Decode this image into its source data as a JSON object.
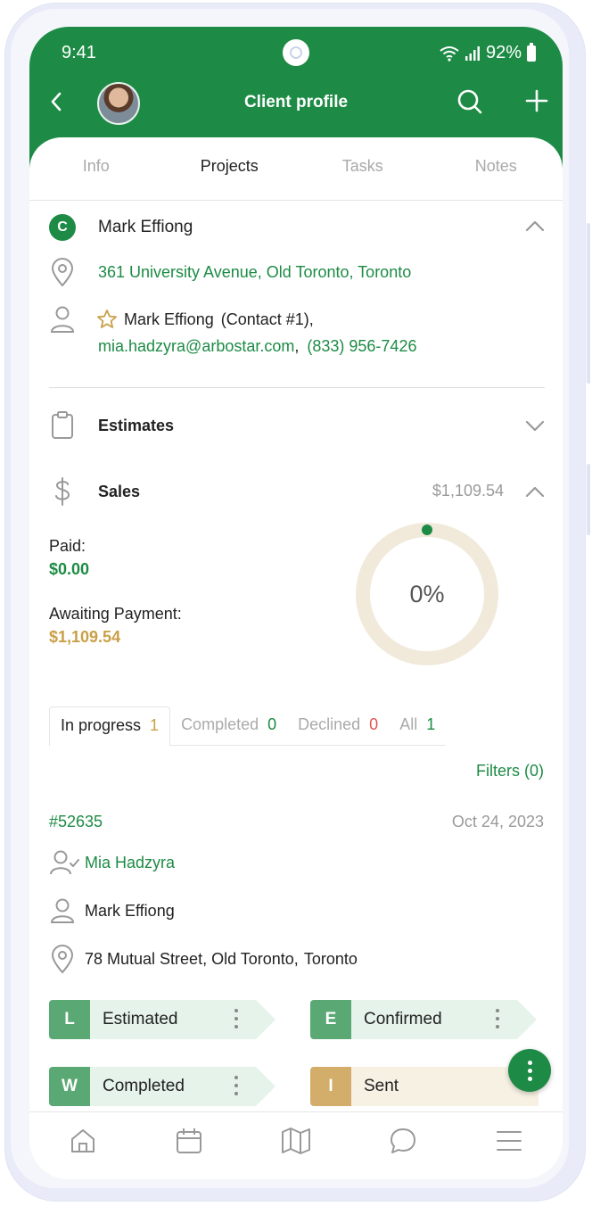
{
  "status": {
    "time": "9:41",
    "battery": "92%"
  },
  "header": {
    "title": "Client profile"
  },
  "tabs": [
    {
      "label": "Info"
    },
    {
      "label": "Projects"
    },
    {
      "label": "Tasks"
    },
    {
      "label": "Notes"
    }
  ],
  "client": {
    "badge": "C",
    "name": "Mark Effiong",
    "address": "361 University Avenue, Old Toronto, Toronto",
    "contact_name": "Mark Effiong",
    "contact_tag": "(Contact #1),",
    "email": "mia.hadzyra@arbostar.com",
    "phone": "(833) 956-7426"
  },
  "sections": {
    "estimates_label": "Estimates",
    "sales_label": "Sales",
    "sales_total": "$1,109.54"
  },
  "sales": {
    "paid_label": "Paid:",
    "paid_value": "$0.00",
    "awaiting_label": "Awaiting Payment:",
    "awaiting_value": "$1,109.54",
    "percent_label": "0%",
    "percent": 0
  },
  "project_tabs": [
    {
      "label": "In progress",
      "count": "1"
    },
    {
      "label": "Completed",
      "count": "0"
    },
    {
      "label": "Declined",
      "count": "0"
    },
    {
      "label": "All",
      "count": "1"
    }
  ],
  "filters_label": "Filters (0)",
  "project": {
    "id": "#52635",
    "date": "Oct 24, 2023",
    "assignee": "Mia Hadzyra",
    "client": "Mark Effiong",
    "address_street": "78 Mutual Street, Old Toronto,",
    "address_city": "Toronto",
    "stages": [
      {
        "letter": "L",
        "label": "Estimated"
      },
      {
        "letter": "E",
        "label": "Confirmed"
      },
      {
        "letter": "W",
        "label": "Completed"
      },
      {
        "letter": "I",
        "label": "Sent"
      }
    ]
  },
  "colors": {
    "brand": "#1d8b45",
    "accent_gold": "#c9a048",
    "stage_green": "#5aa873",
    "stage_green_bg": "#e6f3ea",
    "stage_gold": "#d3ad6a",
    "stage_gold_bg": "#f7f1e4",
    "declined_red": "#e05555"
  },
  "bottom_nav": [
    "home-icon",
    "calendar-icon",
    "map-icon",
    "chat-icon",
    "menu-icon"
  ]
}
